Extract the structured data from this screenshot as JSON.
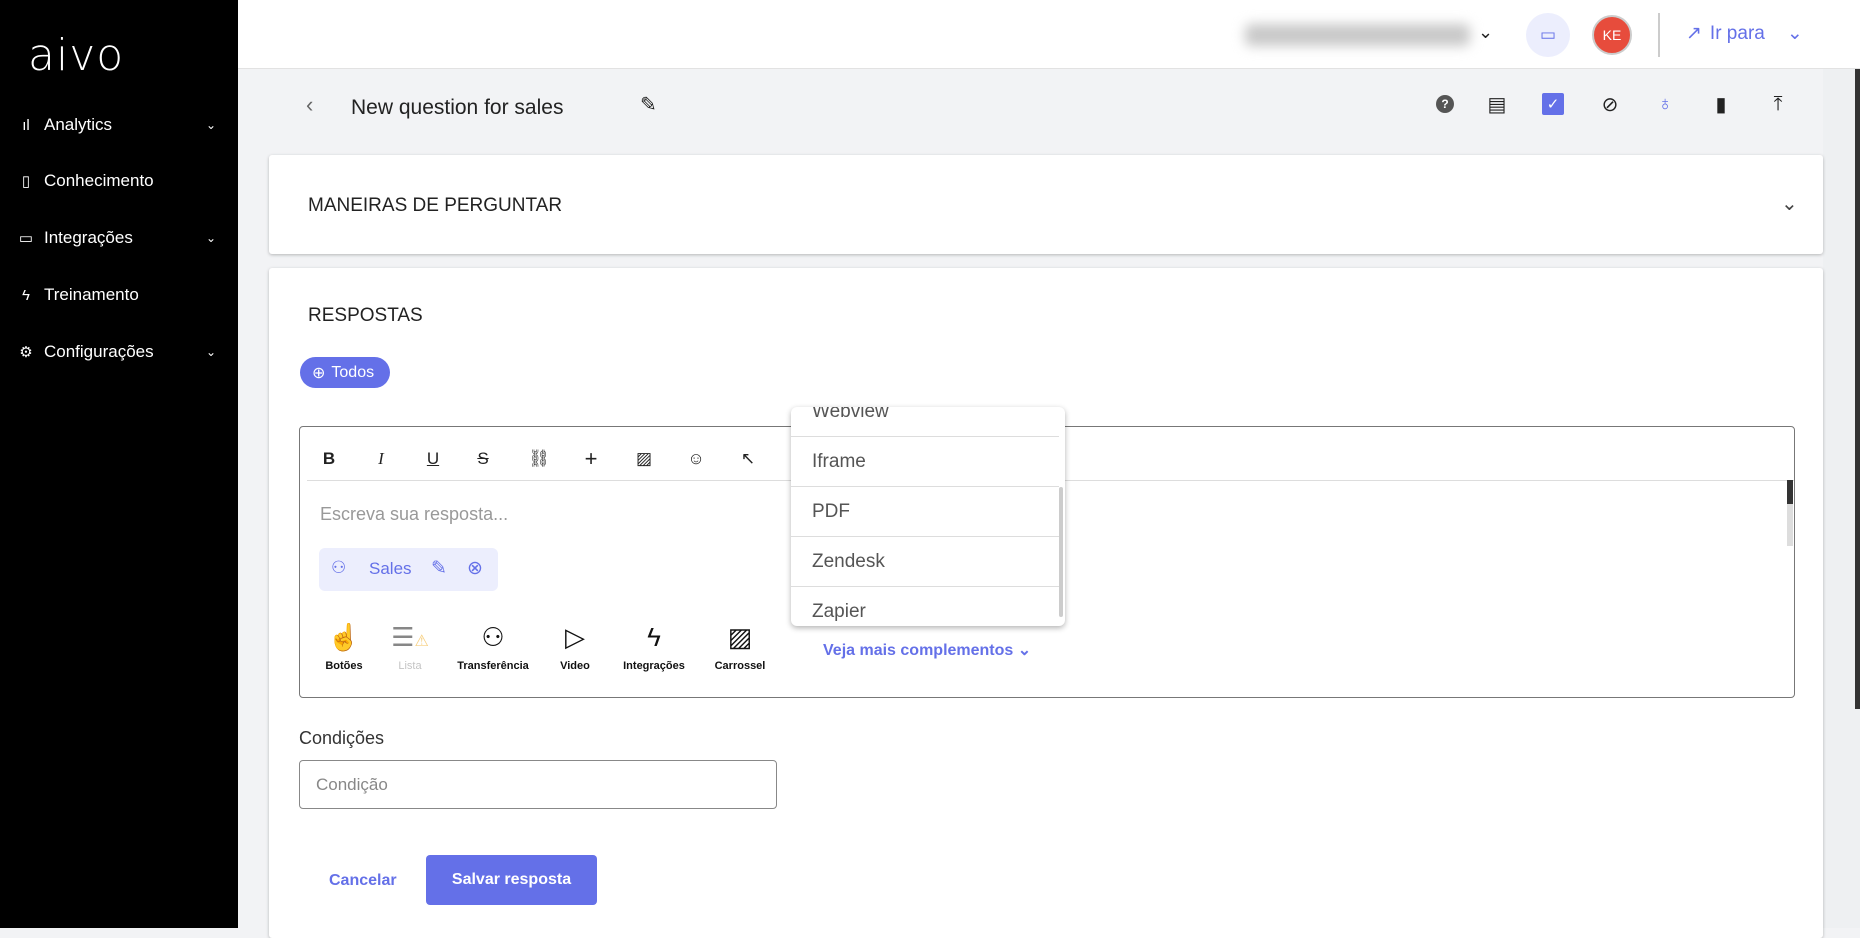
{
  "sidebar": {
    "logo": "aivo",
    "items": [
      {
        "label": "Analytics",
        "icon": "bar-chart-icon",
        "chevron": true
      },
      {
        "label": "Conhecimento",
        "icon": "book-icon",
        "chevron": false
      },
      {
        "label": "Integrações",
        "icon": "chat-icon",
        "chevron": true
      },
      {
        "label": "Treinamento",
        "icon": "lightning-icon",
        "chevron": false
      },
      {
        "label": "Configurações",
        "icon": "gear-icon",
        "chevron": true
      }
    ]
  },
  "topbar": {
    "avatar_initials": "KE",
    "goto_label": "Ir para"
  },
  "titlebar": {
    "title": "New question for sales"
  },
  "section1": {
    "title": "MANEIRAS DE PERGUNTAR"
  },
  "section2": {
    "title": "RESPOSTAS",
    "language_pill": "Todos",
    "editor": {
      "placeholder": "Escreva sua resposta...",
      "chip_label": "Sales",
      "components": [
        "Botões",
        "Lista",
        "Transferência",
        "Video",
        "Integrações",
        "Carrossel"
      ],
      "more_label": "Veja mais complementos"
    },
    "dropdown": [
      "Webview",
      "Iframe",
      "PDF",
      "Zendesk",
      "Zapier"
    ],
    "conditions_label": "Condições",
    "conditions_placeholder": "Condição",
    "cancel_label": "Cancelar",
    "save_label": "Salvar resposta"
  },
  "colors": {
    "accent": "#6470e8",
    "sidebar": "#000000",
    "avatar": "#e74c3c"
  }
}
